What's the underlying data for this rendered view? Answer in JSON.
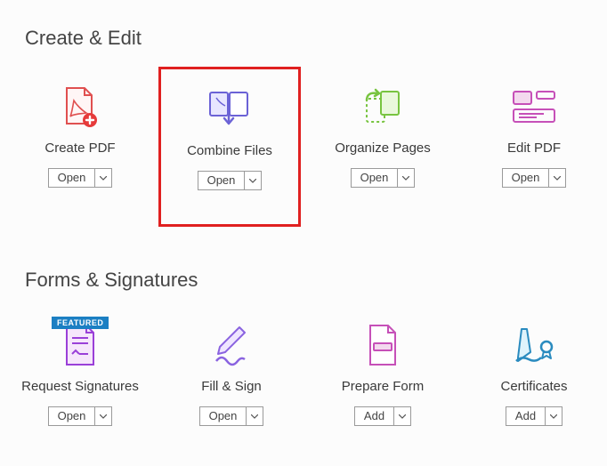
{
  "sections": {
    "create_edit": {
      "title": "Create & Edit"
    },
    "forms_signatures": {
      "title": "Forms & Signatures"
    }
  },
  "tools": {
    "create_pdf": {
      "label": "Create PDF",
      "button": "Open"
    },
    "combine_files": {
      "label": "Combine Files",
      "button": "Open"
    },
    "organize_pages": {
      "label": "Organize Pages",
      "button": "Open"
    },
    "edit_pdf": {
      "label": "Edit PDF",
      "button": "Open"
    },
    "request_sign": {
      "label": "Request Signatures",
      "button": "Open",
      "badge": "FEATURED"
    },
    "fill_sign": {
      "label": "Fill & Sign",
      "button": "Open"
    },
    "prepare_form": {
      "label": "Prepare Form",
      "button": "Add"
    },
    "certificates": {
      "label": "Certificates",
      "button": "Add"
    }
  }
}
